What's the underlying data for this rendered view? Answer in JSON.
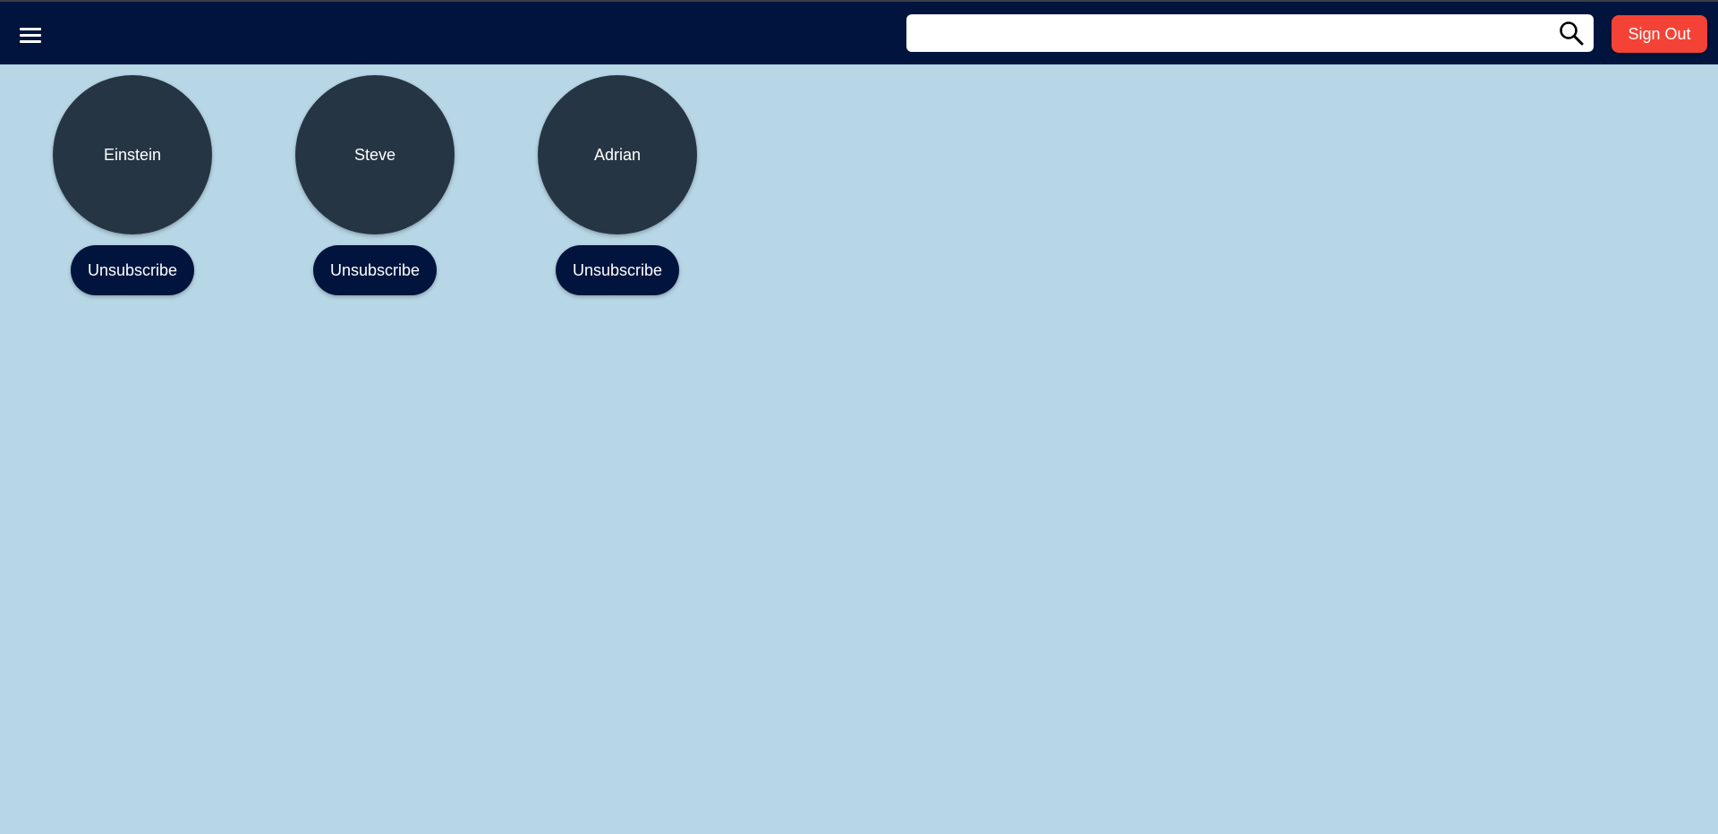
{
  "header": {
    "menu_icon": "hamburger-menu-icon",
    "search": {
      "value": "",
      "placeholder": "",
      "icon": "search-icon"
    },
    "signout_label": "Sign Out"
  },
  "subscriptions": [
    {
      "name": "Einstein",
      "button_label": "Unsubscribe"
    },
    {
      "name": "Steve",
      "button_label": "Unsubscribe"
    },
    {
      "name": "Adrian",
      "button_label": "Unsubscribe"
    }
  ],
  "colors": {
    "appbar": "#00143d",
    "background": "#b7d6e6",
    "avatar": "#263544",
    "signout": "#f44336",
    "unsubscribe": "#00143d"
  }
}
